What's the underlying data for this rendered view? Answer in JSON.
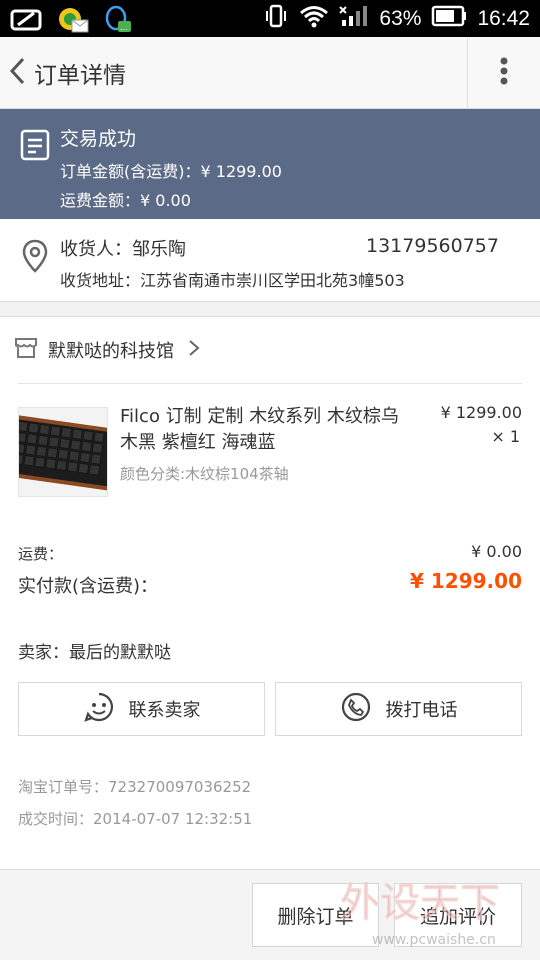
{
  "status_bar": {
    "battery": "63%",
    "time": "16:42"
  },
  "header": {
    "title": "订单详情"
  },
  "status_banner": {
    "title": "交易成功",
    "order_amount_label": "订单金额(含运费)：",
    "order_amount": "¥ 1299.00",
    "shipping_label": "运费金额：",
    "shipping_amount": "¥ 0.00"
  },
  "address": {
    "recipient_label": "收货人：",
    "recipient_name": "邹乐陶",
    "phone": "13179560757",
    "address_label": "收货地址：",
    "address": "江苏省南通市崇川区学田北苑3幢503"
  },
  "store": {
    "name": "默默哒的科技馆"
  },
  "product": {
    "title": "Filco 订制 定制 木纹系列 木纹棕乌木黑 紫檀红 海魂蓝",
    "sku": "颜色分类:木纹棕104茶轴",
    "price": "¥ 1299.00",
    "qty": "× 1"
  },
  "summary": {
    "shipping_label": "运费：",
    "shipping_value": "¥ 0.00",
    "paid_label": "实付款(含运费)：",
    "paid_value": "¥ 1299.00"
  },
  "seller": {
    "label": "卖家：",
    "name": "最后的默默哒"
  },
  "actions": {
    "contact_label": "联系卖家",
    "call_label": "拨打电话"
  },
  "meta": {
    "order_no_label": "淘宝订单号：",
    "order_no": "723270097036252",
    "deal_time_label": "成交时间：",
    "deal_time": "2014-07-07 12:32:51"
  },
  "footer": {
    "delete_label": "删除订单",
    "review_label": "追加评价"
  },
  "watermark": {
    "text_cn": "外设天下",
    "text_url": "www.pcwaishe.cn"
  },
  "colors": {
    "banner_bg": "#5b6a86",
    "accent_orange": "#ff5000"
  }
}
